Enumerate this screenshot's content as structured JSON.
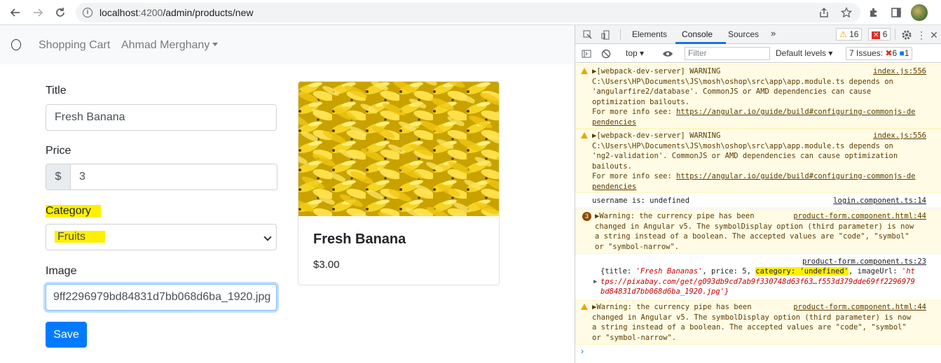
{
  "browser": {
    "url_host": "localhost",
    "url_port": ":4200",
    "url_path": "/admin/products/new"
  },
  "navbar": {
    "brand_icon": "circle-logo-icon",
    "link_cart": "Shopping Cart",
    "user_menu": "Ahmad Merghany"
  },
  "form": {
    "title_label": "Title",
    "title_value": "Fresh Banana",
    "price_label": "Price",
    "price_prefix": "$",
    "price_value": "3",
    "category_label": "Category",
    "category_value": "Fruits",
    "image_label": "Image",
    "image_value": "9ff2296979bd84831d7bb068d6ba_1920.jpg",
    "save_label": "Save"
  },
  "card": {
    "title": "Fresh Banana",
    "price": "$3.00"
  },
  "devtools": {
    "tabs": [
      "Elements",
      "Console",
      "Sources"
    ],
    "active_tab": "Console",
    "warn_count": "16",
    "error_count": "6",
    "context": "top",
    "filter_placeholder": "Filter",
    "levels": "Default levels",
    "issues_label": "7 Issues:",
    "issues_errors": "6",
    "issues_info": "1",
    "messages": [
      {
        "src": "index.js:556",
        "line1": "▶[webpack-dev-server] WARNING",
        "line2": "C:\\Users\\HP\\Documents\\JS\\mosh\\oshop\\src\\app\\app.module.ts depends on",
        "line3": "'angularfire2/database'. CommonJS or AMD dependencies can cause",
        "line4": "optimization bailouts.",
        "line5_pre": "For more info see: ",
        "line5_link": "https://angular.io/guide/build#configuring-commonjs-de",
        "line6_link": "pendencies"
      },
      {
        "src": "index.js:556",
        "line1": "▶[webpack-dev-server] WARNING",
        "line2": "C:\\Users\\HP\\Documents\\JS\\mosh\\oshop\\src\\app\\app.module.ts depends on",
        "line3": "'ng2-validation'. CommonJS or AMD dependencies can cause optimization",
        "line4": "bailouts.",
        "line5_pre": "For more info see: ",
        "line5_link": "https://angular.io/guide/build#configuring-commonjs-de",
        "line6_link": "pendencies"
      },
      {
        "src": "login.component.ts:14",
        "line1": "username is: undefined"
      },
      {
        "count": "3",
        "src": "product-form.component.html:44",
        "line1": "▶Warning: the currency pipe has been",
        "line2": "changed in Angular v5. The symbolDisplay option (third parameter) is now",
        "line3": "a string instead of a boolean. The accepted values are \"code\", \"symbol\"",
        "line4": "or \"symbol-narrow\"."
      },
      {
        "src": "product-form.component.ts:23",
        "line1a": "{title: ",
        "line1b": "'Fresh Bananas'",
        "line1c": ", price: 5, ",
        "line1d": "category: 'undefined'",
        "line1e": ", imageUrl: ",
        "line1f": "'ht",
        "line2": "tps://pixabay.com/get/g093db9cd7ab9f330748d63f63…f553d379dde69ff2296979",
        "line3": "bd84831d7bb068d6ba_1920.jpg'}"
      },
      {
        "src": "product-form.component.html:44",
        "line1": "▶Warning: the currency pipe has been",
        "line2": "changed in Angular v5. The symbolDisplay option (third parameter) is now",
        "line3": "a string instead of a boolean. The accepted values are \"code\", \"symbol\"",
        "line4": "or \"symbol-narrow\"."
      }
    ],
    "prompt": "›"
  },
  "colors": {
    "primary": "#007bff",
    "highlight": "#ffef00",
    "warn_bg": "#fffbe5",
    "devtools_accent": "#1a73e8"
  }
}
